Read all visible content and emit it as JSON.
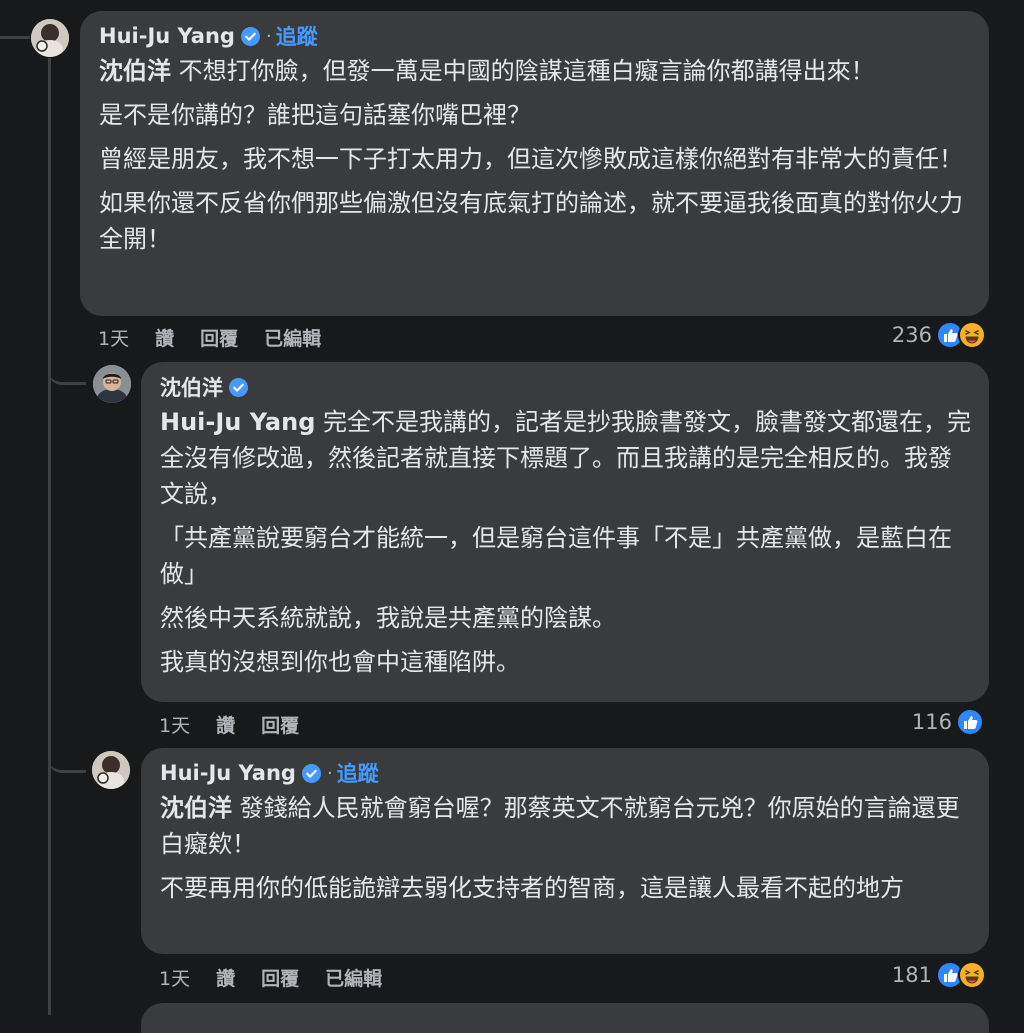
{
  "colors": {
    "background": "#18191a",
    "bubble": "#3a3b3c",
    "text": "#e4e6eb",
    "muted": "#b0b3b8",
    "link": "#4599ff",
    "verified": "#4599ff",
    "like": "#2d88ff",
    "haha": "#f7b125"
  },
  "comments": [
    {
      "author": "Hui-Ju Yang",
      "verified": true,
      "separator": "·",
      "follow_label": "追蹤",
      "mention": "沈伯洋",
      "first_text": " 不想打你臉，但發一萬是中國的陰謀這種白癡言論你都講得出來！",
      "paragraphs": [
        "是不是你講的？誰把這句話塞你嘴巴裡？",
        "曾經是朋友，我不想一下子打太用力，但這次慘敗成這樣你絕對有非常大的責任！",
        "如果你還不反省你們那些偏激但沒有底氣打的論述，就不要逼我後面真的對你火力全開！"
      ],
      "time": "1天",
      "like_label": "讚",
      "reply_label": "回覆",
      "edited_label": "已編輯",
      "reaction_count": "236",
      "reaction_icons": [
        "like-icon",
        "haha-icon"
      ]
    },
    {
      "author": "沈伯洋",
      "verified": true,
      "mention": "Hui-Ju Yang",
      "first_text": " 完全不是我講的，記者是抄我臉書發文，臉書發文都還在，完全沒有修改過，然後記者就直接下標題了。而且我講的是完全相反的。我發文說，",
      "paragraphs": [
        "「共產黨說要窮台才能統一，但是窮台這件事「不是」共產黨做，是藍白在做」",
        "然後中天系統就說，我說是共產黨的陰謀。",
        "我真的沒想到你也會中這種陷阱。"
      ],
      "time": "1天",
      "like_label": "讚",
      "reply_label": "回覆",
      "reaction_count": "116",
      "reaction_icons": [
        "like-icon"
      ]
    },
    {
      "author": "Hui-Ju Yang",
      "verified": true,
      "separator": "·",
      "follow_label": "追蹤",
      "mention": "沈伯洋",
      "first_text": " 發錢給人民就會窮台喔？那蔡英文不就窮台元兇？你原始的言論還更白癡欸！",
      "paragraphs": [
        "不要再用你的低能詭辯去弱化支持者的智商，這是讓人最看不起的地方"
      ],
      "time": "1天",
      "like_label": "讚",
      "reply_label": "回覆",
      "edited_label": "已編輯",
      "reaction_count": "181",
      "reaction_icons": [
        "like-icon",
        "haha-icon"
      ]
    }
  ]
}
